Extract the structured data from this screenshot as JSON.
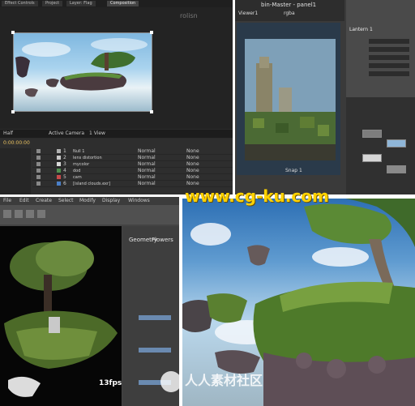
{
  "ae": {
    "tabs": [
      "Effect Controls",
      "Project",
      "Layer: Flag",
      "Composition"
    ],
    "comp_label": "rolisn",
    "viewer_readout": "Half",
    "active_camera": "Active Camera",
    "view_count": "1 View",
    "timecode": "0:00:00:00",
    "layers": [
      {
        "num": "1",
        "name": "Null 1",
        "color": "#b0b0b0"
      },
      {
        "num": "2",
        "name": "lens distortion",
        "color": "#c9c9c9"
      },
      {
        "num": "3",
        "name": "mycolor",
        "color": "#d9d9d9"
      },
      {
        "num": "4",
        "name": "dod",
        "color": "#4f8f4f"
      },
      {
        "num": "5",
        "name": "cam",
        "color": "#c84a4a"
      },
      {
        "num": "6",
        "name": "[island clouds.exr]",
        "color": "#4a7fc8"
      }
    ],
    "mode_label": "Normal",
    "trkmat_label": "None"
  },
  "nuke": {
    "title": "Viewer1",
    "subtitle": "bin-Master - panel1",
    "props_title": "Lantern 1",
    "channel": "rgba",
    "frame_label": "Snap 1"
  },
  "maya": {
    "attr_title": "Geometry",
    "attr_item": "Flowers",
    "fps": "13fps",
    "menus": [
      "File",
      "Edit",
      "Create",
      "Select",
      "Modify",
      "Display",
      "Windows"
    ]
  },
  "watermarks": {
    "center": "www.cg-ku.com",
    "bottom": "人人素材社区"
  }
}
